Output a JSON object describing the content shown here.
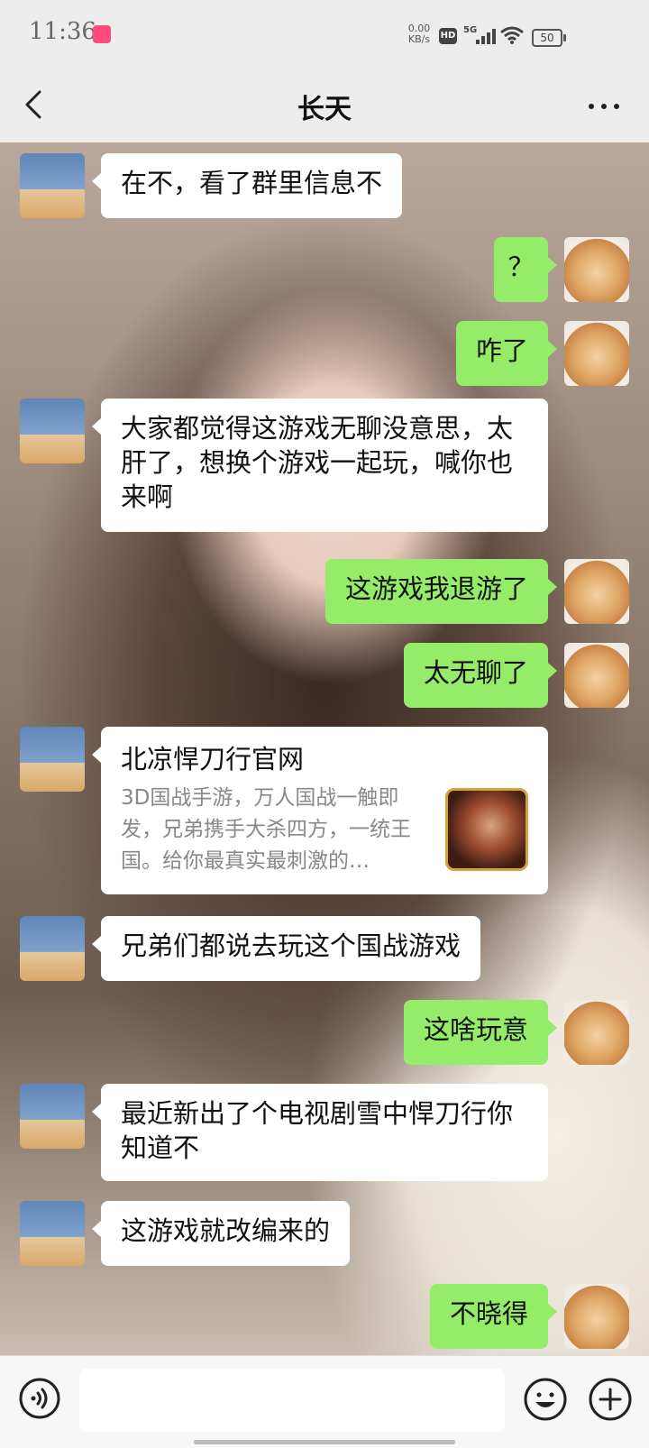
{
  "status_bar": {
    "time": "11:36",
    "net_speed_value": "0.00",
    "net_speed_unit": "KB/s",
    "hd_label": "HD",
    "network_type": "5G",
    "battery_level": "50"
  },
  "header": {
    "title": "长天"
  },
  "messages": [
    {
      "side": "left",
      "type": "text",
      "text": "在不，看了群里信息不"
    },
    {
      "side": "right",
      "type": "text",
      "text": "？"
    },
    {
      "side": "right",
      "type": "text",
      "text": "咋了"
    },
    {
      "side": "left",
      "type": "text",
      "text": "大家都觉得这游戏无聊没意思，太肝了，想换个游戏一起玩，喊你也来啊"
    },
    {
      "side": "right",
      "type": "text",
      "text": "这游戏我退游了"
    },
    {
      "side": "right",
      "type": "text",
      "text": "太无聊了"
    },
    {
      "side": "left",
      "type": "link",
      "title": "北凉悍刀行官网",
      "description": "3D国战手游，万人国战一触即发，兄弟携手大杀四方，一统王国。给你最真实最刺激的…"
    },
    {
      "side": "left",
      "type": "text",
      "text": "兄弟们都说去玩这个国战游戏"
    },
    {
      "side": "right",
      "type": "text",
      "text": "这啥玩意"
    },
    {
      "side": "left",
      "type": "text",
      "text": "最近新出了个电视剧雪中悍刀行你知道不"
    },
    {
      "side": "left",
      "type": "text",
      "text": "这游戏就改编来的"
    },
    {
      "side": "right",
      "type": "text",
      "text": "不晓得"
    }
  ],
  "input_bar": {
    "placeholder": "",
    "value": ""
  },
  "colors": {
    "sent_bubble": "#95ec69",
    "received_bubble": "#ffffff",
    "bar_background": "#ededed"
  },
  "icons": [
    "back-arrow",
    "more-dots",
    "voice",
    "emoji",
    "plus"
  ]
}
